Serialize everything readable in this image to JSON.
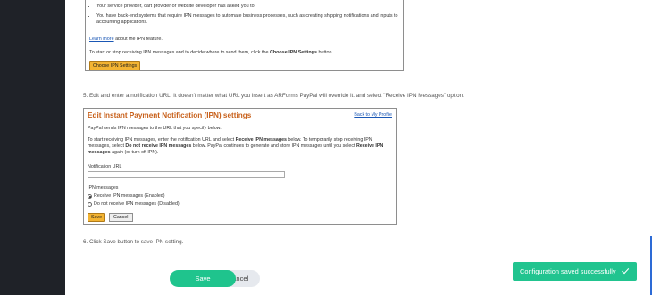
{
  "pane1": {
    "bullet1": "Your service provider, cart provider or website developer has asked you to",
    "bullet2": "You have back-end systems that require IPN messages to automate business processes, such as creating shipping notifications and inputs to accounting applications.",
    "learn_more_link": "Learn more",
    "learn_more_rest": " about the IPN feature.",
    "start_text_prefix": "To start or stop receiving IPN messages and to decide where to send them, click the ",
    "start_text_bold": "Choose IPN Settings",
    "start_text_suffix": " button.",
    "choose_button": "Choose IPN Settings"
  },
  "step5": "5. Edit and enter a notification URL. It doesn't matter what URL you insert as ARForms PayPal will override it. and select \"Receive IPN Messages\" option.",
  "pane2": {
    "title": "Edit Instant Payment Notification (IPN) settings",
    "back_link": "Back to My Profile",
    "p1": "PayPal sends IPN messages to the URL that you specify below.",
    "p2_a": "To start receiving IPN messages, enter the notification URL and select ",
    "p2_b": "Receive IPN messages",
    "p2_c": " below. To temporarily stop receiving IPN messages, select ",
    "p2_d": "Do not receive IPN messages",
    "p2_e": " below. PayPal continues to generate and store IPN messages until you select ",
    "p2_f": "Receive IPN messages",
    "p2_g": " again (or turn off IPN).",
    "notification_label": "Notification URL",
    "notification_value": "",
    "ipn_label": "IPN messages",
    "radio_enabled": "Receive IPN messages (Enabled)",
    "radio_disabled": "Do not receive IPN messages (Disabled)",
    "save_button": "Save",
    "cancel_button": "Cancel"
  },
  "step6": "6. Click Save button to save IPN setting.",
  "actions": {
    "save": "Save",
    "cancel": "Cancel"
  },
  "toast": {
    "message": "Configuration saved successfully",
    "icon": "check-icon",
    "color": "#21c48f"
  },
  "colors": {
    "accent_green": "#1fc48d",
    "sidebar": "#1f2228",
    "paypal_title": "#c8601a",
    "link": "#1a57b5"
  }
}
